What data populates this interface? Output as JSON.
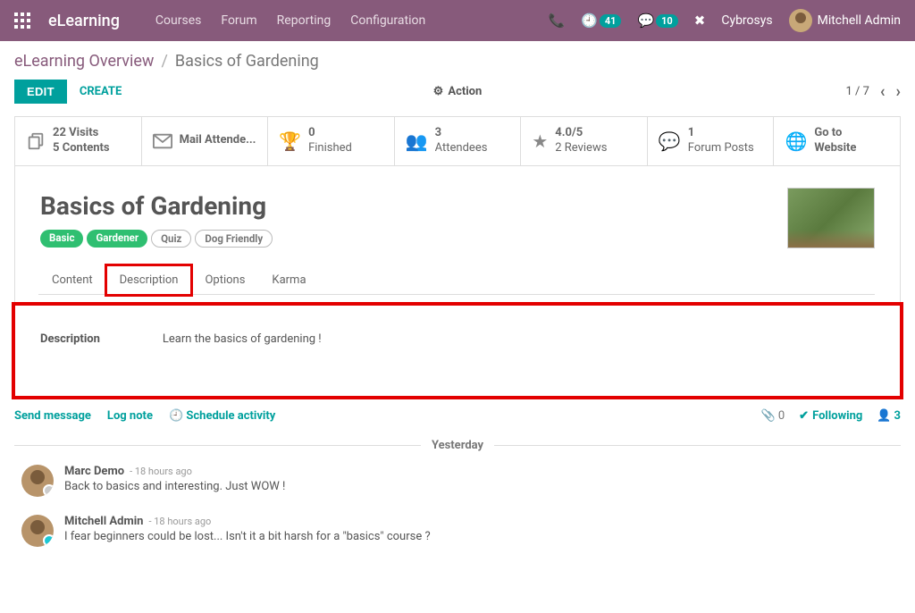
{
  "nav": {
    "brand": "eLearning",
    "links": [
      "Courses",
      "Forum",
      "Reporting",
      "Configuration"
    ],
    "badge1": "41",
    "badge2": "10",
    "company": "Cybrosys",
    "user": "Mitchell Admin"
  },
  "breadcrumb": {
    "root": "eLearning Overview",
    "sep": "/",
    "current": "Basics of Gardening"
  },
  "controls": {
    "edit": "EDIT",
    "create": "CREATE",
    "action": "Action",
    "pager": "1 / 7"
  },
  "stats": {
    "visits_l1": "22 Visits",
    "visits_l2": "5 Contents",
    "mail": "Mail Attende...",
    "finished_n": "0",
    "finished_l": "Finished",
    "att_n": "3",
    "att_l": "Attendees",
    "rev_n": "4.0/5",
    "rev_l": "2 Reviews",
    "forum_n": "1",
    "forum_l": "Forum Posts",
    "web_l1": "Go to",
    "web_l2": "Website"
  },
  "record": {
    "title": "Basics of Gardening",
    "tags": [
      "Basic",
      "Gardener",
      "Quiz",
      "Dog Friendly"
    ]
  },
  "tabs": [
    "Content",
    "Description",
    "Options",
    "Karma"
  ],
  "description": {
    "label": "Description",
    "value": "Learn the basics of gardening !"
  },
  "chatter": {
    "send": "Send message",
    "log": "Log note",
    "schedule": "Schedule activity",
    "attachments": "0",
    "following": "Following",
    "followers": "3",
    "separator": "Yesterday",
    "messages": [
      {
        "author": "Marc Demo",
        "time": "- 18 hours ago",
        "body": "Back to basics and interesting. Just WOW !"
      },
      {
        "author": "Mitchell Admin",
        "time": "- 18 hours ago",
        "body": "I fear beginners could be lost... Isn't it a bit harsh for a \"basics\" course ?"
      }
    ]
  }
}
